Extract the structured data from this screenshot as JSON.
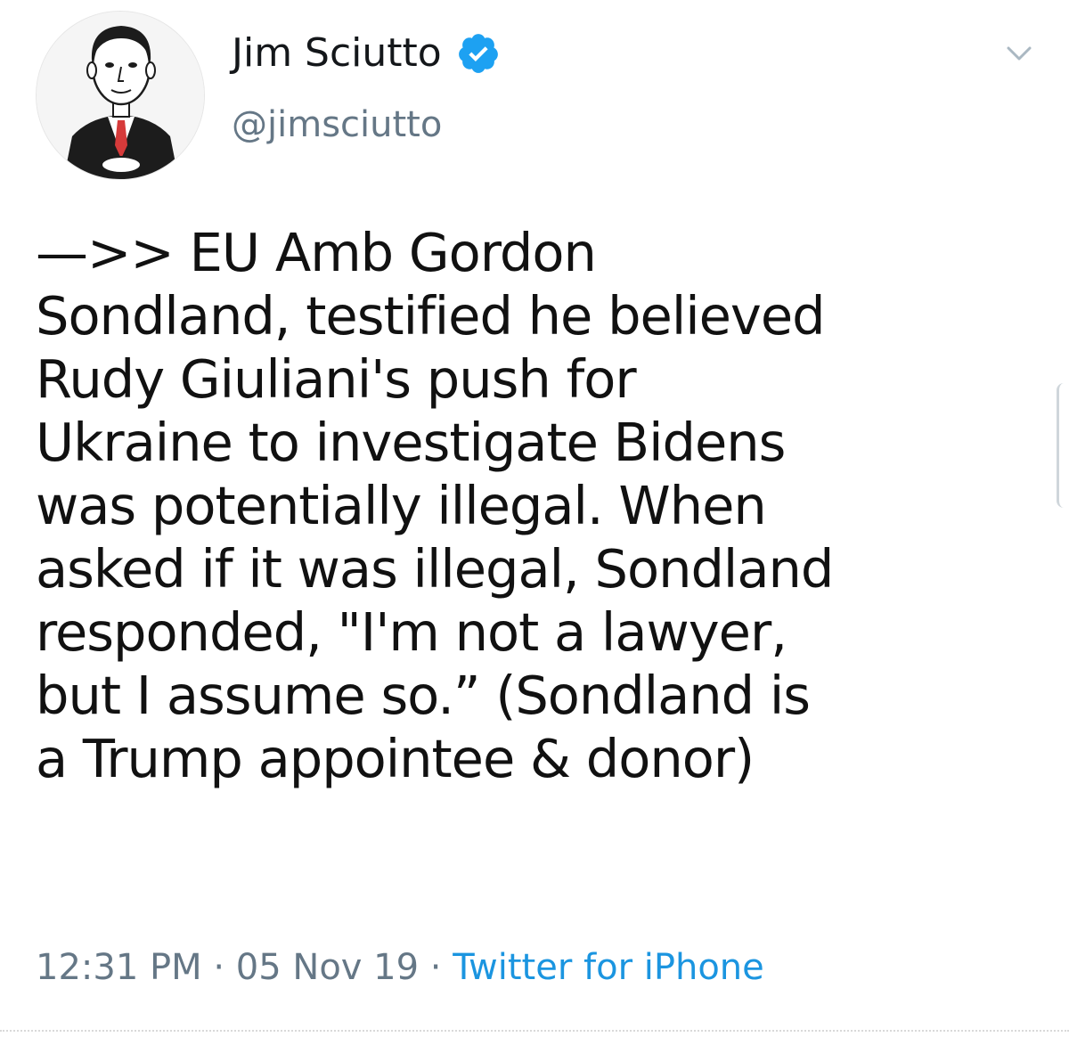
{
  "tweet": {
    "author": {
      "display_name": "Jim Sciutto",
      "handle": "@jimsciutto",
      "verified_icon": "verified-badge-icon",
      "avatar_icon": "caricature-avatar"
    },
    "menu_icon": "chevron-down-icon",
    "text_lines": [
      "—>> EU Amb Gordon",
      "Sondland, testified he believed",
      "Rudy Giuliani's push for",
      "Ukraine to investigate Bidens",
      "was potentially illegal. When",
      "asked if it was illegal, Sondland",
      "responded, \"I'm not a lawyer,",
      "but I assume so.” (Sondland is",
      "a Trump appointee & donor)"
    ],
    "meta": {
      "time": "12:31 PM",
      "separator": " · ",
      "date": "05 Nov 19",
      "source": "Twitter for iPhone"
    }
  },
  "colors": {
    "verified_blue": "#1da1f2",
    "link_blue": "#1b95e0",
    "secondary_text": "#657786"
  }
}
